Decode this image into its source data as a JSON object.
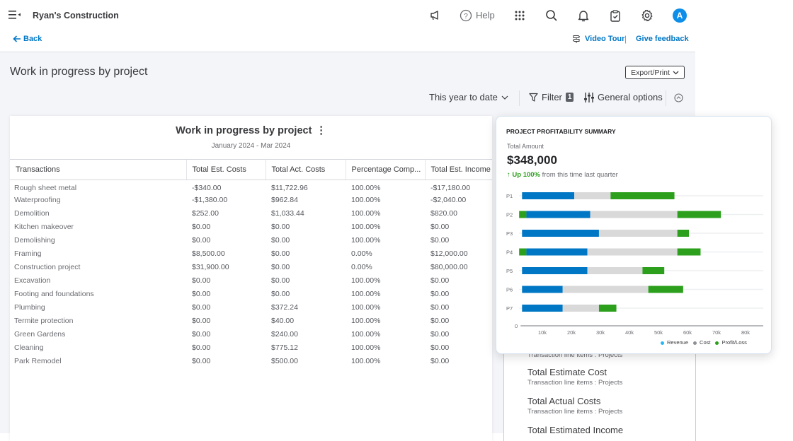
{
  "header": {
    "company_name": "Ryan's Construction",
    "help_label": "Help",
    "avatar_initial": "A",
    "icons": [
      "menu-icon",
      "megaphone-icon",
      "help-icon",
      "apps-grid-icon",
      "search-icon",
      "bell-icon",
      "clipboard-check-icon",
      "gear-icon"
    ]
  },
  "subbar": {
    "back_label": "Back",
    "video_tour_label": "Video Tour",
    "separator": "|",
    "feedback_label": "Give feedback"
  },
  "page": {
    "title": "Work in progress by project",
    "export_label": "Export/Print",
    "date_range_label": "This year to date",
    "filter_label": "Filter",
    "filter_count": "1",
    "general_options_label": "General options"
  },
  "report": {
    "title": "Work in progress by project",
    "subtitle": "January 2024 - Mar 2024",
    "columns": [
      "Transactions",
      "Total Est. Costs",
      "Total Act. Costs",
      "Percentage Comp...",
      "Total Est. Income"
    ],
    "rows": [
      [
        "Rough sheet metal",
        "-$340.00",
        "$11,722.96",
        "100.00%",
        "-$17,180.00"
      ],
      [
        "Waterproofing",
        "-$1,380.00",
        "$962.84",
        "100.00%",
        "-$2,040.00"
      ],
      [
        "Demolition",
        "$252.00",
        "$1,033.44",
        "100.00%",
        "$820.00"
      ],
      [
        "Kitchen makeover",
        "$0.00",
        "$0.00",
        "100.00%",
        "$0.00"
      ],
      [
        "Demolishing",
        "$0.00",
        "$0.00",
        "100.00%",
        "$0.00"
      ],
      [
        "Framing",
        "$8,500.00",
        "$0.00",
        "0.00%",
        "$12,000.00"
      ],
      [
        "Construction project",
        "$31,900.00",
        "$0.00",
        "0.00%",
        "$80,000.00"
      ],
      [
        "Excavation",
        "$0.00",
        "$0.00",
        "100.00%",
        "$0.00"
      ],
      [
        "Footing and foundations",
        "$0.00",
        "$0.00",
        "100.00%",
        "$0.00"
      ],
      [
        "Plumbing",
        "$0.00",
        "$372.24",
        "100.00%",
        "$0.00"
      ],
      [
        "Termite protection",
        "$0.00",
        "$40.00",
        "100.00%",
        "$0.00"
      ],
      [
        "Green Gardens",
        "$0.00",
        "$240.00",
        "100.00%",
        "$0.00"
      ],
      [
        "Cleaning",
        "$0.00",
        "$775.12",
        "100.00%",
        "$0.00"
      ],
      [
        "Park Remodel",
        "$0.00",
        "$500.00",
        "100.00%",
        "$0.00"
      ]
    ]
  },
  "side_panel": {
    "partial_top_sub": "Transaction line items : Projects",
    "items": [
      {
        "title": "Total Estimate Cost",
        "sub": "Transaction line items : Projects"
      },
      {
        "title": "Total Actual Costs",
        "sub": "Transaction line items : Projects"
      },
      {
        "title": "Total Estimated Income",
        "sub": ""
      }
    ]
  },
  "summary_card": {
    "title": "PROJECT PROFITABILITY SUMMARY",
    "amount_label": "Total Amount",
    "amount": "$348,000",
    "trend_value": "Up 100%",
    "trend_text": " from this time last quarter"
  },
  "chart_data": {
    "type": "bar",
    "orientation": "horizontal-stacked",
    "categories": [
      "P1",
      "P2",
      "P3",
      "P4",
      "P5",
      "P6",
      "P7"
    ],
    "colors": {
      "Revenue": "#0077c5",
      "Cost": "#d9d9d9",
      "Profit/Loss": "#2ca01c"
    },
    "legend_colors": {
      "Revenue": "#29b6f6",
      "Cost": "#8d9096",
      "Profit/Loss": "#2ca01c"
    },
    "segments": [
      [
        {
          "series": "Revenue",
          "from": 3,
          "to": 21
        },
        {
          "series": "Cost",
          "from": 21,
          "to": 33.5
        },
        {
          "series": "Profit/Loss",
          "from": 33.5,
          "to": 55.5
        }
      ],
      [
        {
          "series": "Profit/Loss",
          "from": 2,
          "to": 4.5
        },
        {
          "series": "Revenue",
          "from": 4.5,
          "to": 26.5
        },
        {
          "series": "Cost",
          "from": 26.5,
          "to": 56.5
        },
        {
          "series": "Profit/Loss",
          "from": 56.5,
          "to": 71.5
        }
      ],
      [
        {
          "series": "Revenue",
          "from": 3,
          "to": 29.5
        },
        {
          "series": "Cost",
          "from": 29.5,
          "to": 56.5
        },
        {
          "series": "Profit/Loss",
          "from": 56.5,
          "to": 60.5
        }
      ],
      [
        {
          "series": "Profit/Loss",
          "from": 2,
          "to": 4.5
        },
        {
          "series": "Revenue",
          "from": 4.5,
          "to": 25.5
        },
        {
          "series": "Cost",
          "from": 25.5,
          "to": 56.5
        },
        {
          "series": "Profit/Loss",
          "from": 56.5,
          "to": 64.5
        }
      ],
      [
        {
          "series": "Revenue",
          "from": 3,
          "to": 25.5
        },
        {
          "series": "Cost",
          "from": 25.5,
          "to": 44.5
        },
        {
          "series": "Profit/Loss",
          "from": 44.5,
          "to": 52
        }
      ],
      [
        {
          "series": "Revenue",
          "from": 3,
          "to": 17
        },
        {
          "series": "Cost",
          "from": 17,
          "to": 46.5
        },
        {
          "series": "Profit/Loss",
          "from": 46.5,
          "to": 58.5
        }
      ],
      [
        {
          "series": "Revenue",
          "from": 3,
          "to": 17
        },
        {
          "series": "Cost",
          "from": 17,
          "to": 29.5
        },
        {
          "series": "Profit/Loss",
          "from": 29.5,
          "to": 35.5
        }
      ]
    ],
    "units": "thousands",
    "xlim": [
      0,
      86
    ],
    "x_ticks": [
      10,
      20,
      30,
      40,
      50,
      60,
      70,
      80
    ],
    "x_tick_labels": [
      "10k",
      "20k",
      "30k",
      "40k",
      "50k",
      "60k",
      "70k",
      "80k"
    ],
    "y_zero_label": "0",
    "legend": [
      "Revenue",
      "Cost",
      "Profit/Loss"
    ],
    "legend_position": "bottom-right",
    "grid": true
  }
}
